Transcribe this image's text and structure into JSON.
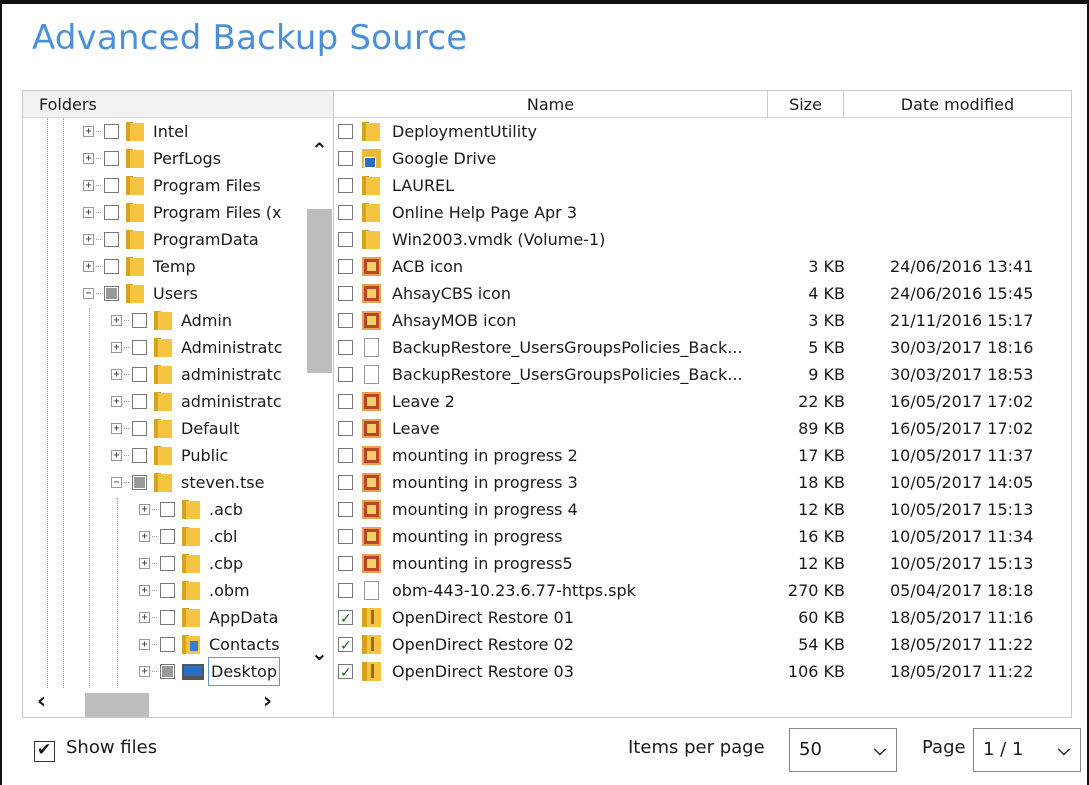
{
  "window": {
    "title": "Advanced Backup Source"
  },
  "folders_pane": {
    "header": "Folders",
    "nodes": [
      {
        "label": "Intel",
        "level": 1,
        "state": "unchecked"
      },
      {
        "label": "PerfLogs",
        "level": 1,
        "state": "unchecked"
      },
      {
        "label": "Program Files",
        "level": 1,
        "state": "unchecked"
      },
      {
        "label": "Program Files (x",
        "level": 1,
        "state": "unchecked"
      },
      {
        "label": "ProgramData",
        "level": 1,
        "state": "unchecked"
      },
      {
        "label": "Temp",
        "level": 1,
        "state": "unchecked"
      },
      {
        "label": "Users",
        "level": 1,
        "state": "partial",
        "expanded": true
      },
      {
        "label": "Admin",
        "level": 2,
        "state": "unchecked"
      },
      {
        "label": "Administratc",
        "level": 2,
        "state": "unchecked"
      },
      {
        "label": "administratc",
        "level": 2,
        "state": "unchecked"
      },
      {
        "label": "administratc",
        "level": 2,
        "state": "unchecked"
      },
      {
        "label": "Default",
        "level": 2,
        "state": "unchecked"
      },
      {
        "label": "Public",
        "level": 2,
        "state": "unchecked"
      },
      {
        "label": "steven.tse",
        "level": 2,
        "state": "partial",
        "expanded": true
      },
      {
        "label": ".acb",
        "level": 3,
        "state": "unchecked"
      },
      {
        "label": ".cbl",
        "level": 3,
        "state": "unchecked"
      },
      {
        "label": ".cbp",
        "level": 3,
        "state": "unchecked"
      },
      {
        "label": ".obm",
        "level": 3,
        "state": "unchecked"
      },
      {
        "label": "AppData",
        "level": 3,
        "state": "unchecked"
      },
      {
        "label": "Contacts",
        "level": 3,
        "state": "unchecked",
        "icon": "contacts-folder-icon"
      },
      {
        "label": "Desktop",
        "level": 3,
        "state": "partial",
        "icon": "desktop-icon",
        "selected": true
      }
    ]
  },
  "file_list": {
    "columns": {
      "name": "Name",
      "size": "Size",
      "date": "Date modified"
    },
    "rows": [
      {
        "name": "DeploymentUtility",
        "size": "",
        "date": "",
        "checked": false,
        "icon": "folder-icon"
      },
      {
        "name": "Google Drive",
        "size": "",
        "date": "",
        "checked": false,
        "icon": "drive-shortcut-icon"
      },
      {
        "name": "LAUREL",
        "size": "",
        "date": "",
        "checked": false,
        "icon": "folder-icon"
      },
      {
        "name": "Online Help Page Apr 3",
        "size": "",
        "date": "",
        "checked": false,
        "icon": "folder-icon"
      },
      {
        "name": "Win2003.vmdk (Volume-1)",
        "size": "",
        "date": "",
        "checked": false,
        "icon": "folder-icon"
      },
      {
        "name": "ACB icon",
        "size": "3 KB",
        "date": "24/06/2016 13:41",
        "checked": false,
        "icon": "image-file-icon"
      },
      {
        "name": "AhsayCBS icon",
        "size": "4 KB",
        "date": "24/06/2016 15:45",
        "checked": false,
        "icon": "image-file-icon"
      },
      {
        "name": "AhsayMOB icon",
        "size": "3 KB",
        "date": "21/11/2016 15:17",
        "checked": false,
        "icon": "image-file-icon"
      },
      {
        "name": "BackupRestore_UsersGroupsPolicies_Back...",
        "size": "5 KB",
        "date": "30/03/2017 18:16",
        "checked": false,
        "icon": "document-icon"
      },
      {
        "name": "BackupRestore_UsersGroupsPolicies_Back...",
        "size": "9 KB",
        "date": "30/03/2017 18:53",
        "checked": false,
        "icon": "document-icon"
      },
      {
        "name": "Leave 2",
        "size": "22 KB",
        "date": "16/05/2017 17:02",
        "checked": false,
        "icon": "image-file-icon"
      },
      {
        "name": "Leave",
        "size": "89 KB",
        "date": "16/05/2017 17:02",
        "checked": false,
        "icon": "image-file-icon"
      },
      {
        "name": "mounting in progress 2",
        "size": "17 KB",
        "date": "10/05/2017 11:37",
        "checked": false,
        "icon": "image-file-icon"
      },
      {
        "name": "mounting in progress 3",
        "size": "18 KB",
        "date": "10/05/2017 14:05",
        "checked": false,
        "icon": "image-file-icon"
      },
      {
        "name": "mounting in progress 4",
        "size": "12 KB",
        "date": "10/05/2017 15:13",
        "checked": false,
        "icon": "image-file-icon"
      },
      {
        "name": "mounting in progress",
        "size": "16 KB",
        "date": "10/05/2017 11:34",
        "checked": false,
        "icon": "image-file-icon"
      },
      {
        "name": "mounting in progress5",
        "size": "12 KB",
        "date": "10/05/2017 15:13",
        "checked": false,
        "icon": "image-file-icon"
      },
      {
        "name": "obm-443-10.23.6.77-https.spk",
        "size": "270 KB",
        "date": "05/04/2017 18:18",
        "checked": false,
        "icon": "document-icon"
      },
      {
        "name": "OpenDirect Restore 01",
        "size": "60 KB",
        "date": "18/05/2017 11:16",
        "checked": true,
        "icon": "zip-archive-icon"
      },
      {
        "name": "OpenDirect Restore 02",
        "size": "54 KB",
        "date": "18/05/2017 11:22",
        "checked": true,
        "icon": "zip-archive-icon"
      },
      {
        "name": "OpenDirect Restore 03",
        "size": "106 KB",
        "date": "18/05/2017 11:22",
        "checked": true,
        "icon": "zip-archive-icon"
      }
    ]
  },
  "footer": {
    "show_files_label": "Show files",
    "show_files_checked": true,
    "items_per_page_label": "Items per page",
    "items_per_page_value": "50",
    "page_label": "Page",
    "page_value": "1 / 1"
  },
  "colors": {
    "title": "#4a90d9",
    "folder": "#f5c542",
    "scroll_thumb": "#bdbdbd"
  }
}
